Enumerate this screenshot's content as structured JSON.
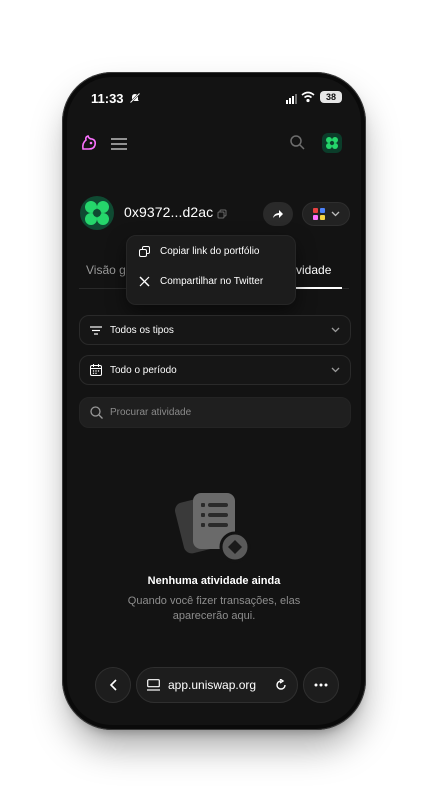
{
  "status": {
    "time": "11:33",
    "battery": "38",
    "icons": [
      "bell-off-icon",
      "signal-icon",
      "wifi-icon",
      "battery-icon"
    ]
  },
  "header": {
    "icons": [
      "uniswap-logo-icon",
      "menu-icon",
      "search-icon",
      "avatar-icon"
    ]
  },
  "wallet": {
    "address": "0x9372...d2ac",
    "avatar_color": "#25d66b"
  },
  "tabs": [
    {
      "label": "Visão g"
    },
    {
      "label": "tividade"
    }
  ],
  "popup": {
    "items": [
      {
        "label": "Copiar link do portfólio",
        "icon": "copy-link-icon"
      },
      {
        "label": "Compartilhar no Twitter",
        "icon": "x-twitter-icon"
      }
    ]
  },
  "filters": {
    "type": {
      "label": "Todos os tipos"
    },
    "period": {
      "label": "Todo o período"
    }
  },
  "search": {
    "placeholder": "Procurar atividade"
  },
  "empty": {
    "title": "Nenhuma atividade ainda",
    "line1": "Quando você fizer transações, elas",
    "line2": "aparecerão aqui."
  },
  "browser": {
    "url": "app.uniswap.org"
  },
  "colors": {
    "background": "#131313",
    "accent_pink": "#fc72ff",
    "brand_green": "#25d66b"
  }
}
